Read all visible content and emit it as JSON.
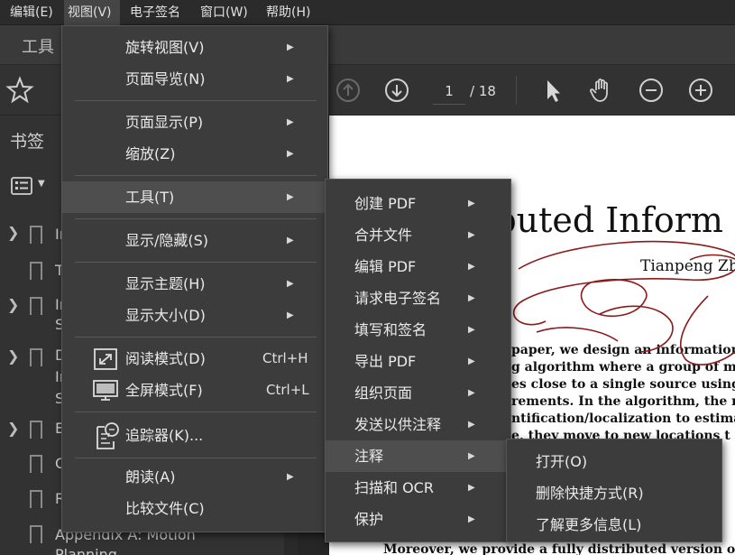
{
  "menubar": {
    "items": [
      {
        "label": "编辑(E)"
      },
      {
        "label": "视图(V)"
      },
      {
        "label": "电子签名"
      },
      {
        "label": "窗口(W)"
      },
      {
        "label": "帮助(H)"
      }
    ]
  },
  "tabbar": {
    "tools_label": "工具"
  },
  "toolbar": {
    "page_current": "1",
    "page_total": "/ 18"
  },
  "sidebar": {
    "title": "书签",
    "bookmarks": [
      {
        "text": "In"
      },
      {
        "text": "T"
      },
      {
        "text": "In"
      },
      {
        "text": "S"
      },
      {
        "text": "D"
      },
      {
        "text": "In"
      },
      {
        "text": "S"
      },
      {
        "text": "E"
      },
      {
        "text": "C"
      },
      {
        "text": "R"
      },
      {
        "text": "Appendix A: Motion"
      },
      {
        "text": "Planning"
      }
    ]
  },
  "view_menu": {
    "items": [
      {
        "label": "旋转视图(V)"
      },
      {
        "label": "页面导览(N)"
      },
      {
        "label": "页面显示(P)"
      },
      {
        "label": "缩放(Z)"
      },
      {
        "label": "工具(T)"
      },
      {
        "label": "显示/隐藏(S)"
      },
      {
        "label": "显示主题(H)"
      },
      {
        "label": "显示大小(D)"
      },
      {
        "label": "阅读模式(D)",
        "shortcut": "Ctrl+H"
      },
      {
        "label": "全屏模式(F)",
        "shortcut": "Ctrl+L"
      },
      {
        "label": "追踪器(K)..."
      },
      {
        "label": "朗读(A)"
      },
      {
        "label": "比较文件(C)"
      }
    ]
  },
  "tools_menu": {
    "items": [
      {
        "label": "创建 PDF"
      },
      {
        "label": "合并文件"
      },
      {
        "label": "编辑 PDF"
      },
      {
        "label": "请求电子签名"
      },
      {
        "label": "填写和签名"
      },
      {
        "label": "导出 PDF"
      },
      {
        "label": "组织页面"
      },
      {
        "label": "发送以供注释"
      },
      {
        "label": "注释"
      },
      {
        "label": "扫描和 OCR"
      },
      {
        "label": "保护"
      }
    ]
  },
  "comment_menu": {
    "items": [
      {
        "label": "打开(O)"
      },
      {
        "label": "删除快捷方式(R)"
      },
      {
        "label": "了解更多信息(L)"
      }
    ]
  },
  "document": {
    "title_fragment": "ributed Inform",
    "author_fragment": "Tianpeng Zh",
    "abstract_lines": [
      "paper, we design an information-b",
      "g algorithm where a group of mo",
      "es close to a single source using",
      "rements. In the algorithm, the mo",
      "ntification/localization to estimate",
      "e, they move to new locations t",
      "Moreover, we provide a fully distributed version of our"
    ],
    "ink_color": "#8b1a1a"
  },
  "colors": {
    "menu_bg": "#3c3c3c",
    "highlight": "#4e4e4e",
    "app_bg": "#323232"
  }
}
